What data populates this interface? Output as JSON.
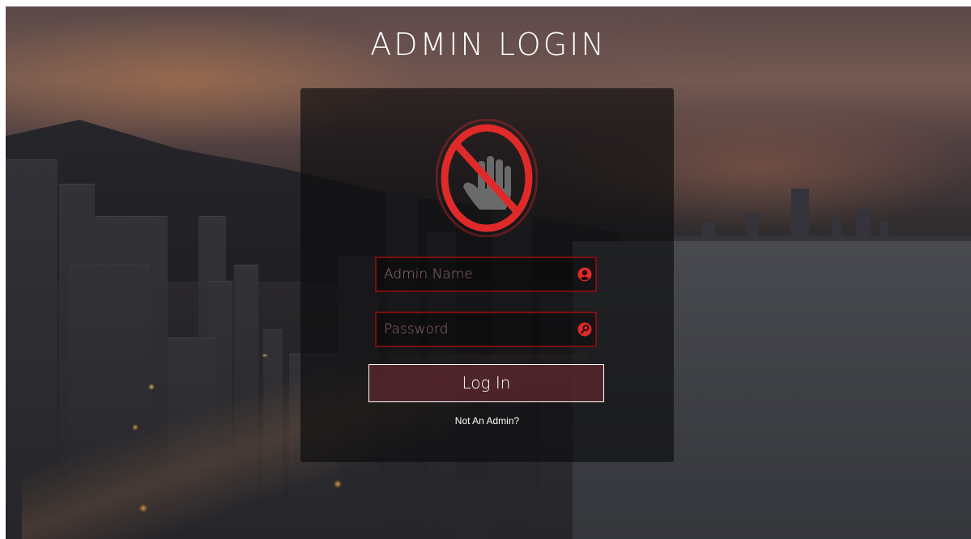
{
  "page": {
    "title": "ADMIN LOGIN"
  },
  "login_form": {
    "logo_icon": "no-entry-hand-icon",
    "username": {
      "placeholder": "Admin Name",
      "value": "",
      "icon": "user-icon"
    },
    "password": {
      "placeholder": "Password",
      "value": "",
      "icon": "key-icon"
    },
    "submit_label": "Log In",
    "alt_link_label": "Not An Admin?"
  },
  "colors": {
    "accent_red": "#e02a2a",
    "field_border": "#7a0f0f",
    "button_fill": "#5f2830"
  }
}
